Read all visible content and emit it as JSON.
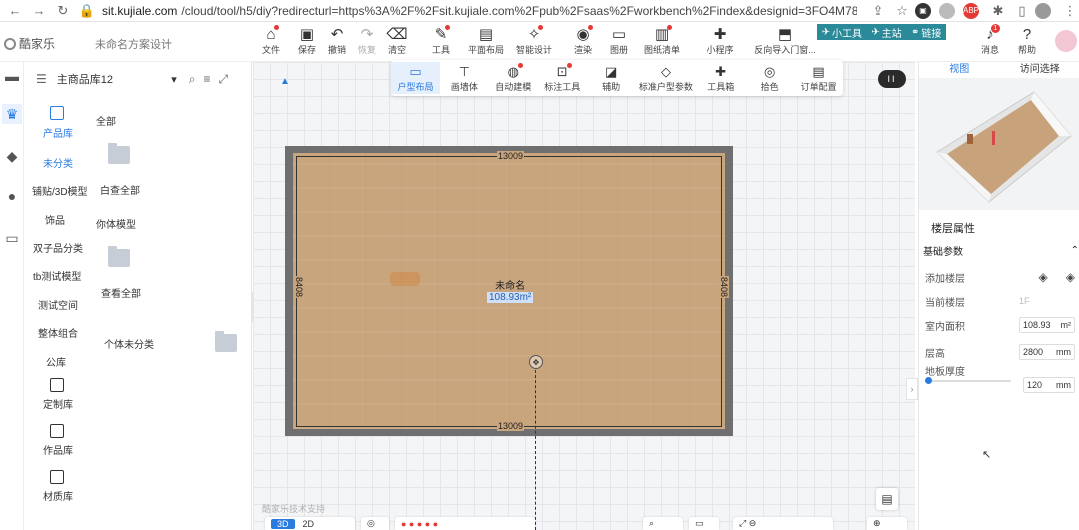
{
  "browser": {
    "url_host": "sit.kujiale.com",
    "url_path": "/cloud/tool/h5/diy?redirecturl=https%3A%2F%2Fsit.kujiale.com%2Fpub%2Fsaas%2Fworkbench%2Findex&designid=3FO4M78QXU7W&...",
    "ext_badge": "ABP"
  },
  "header": {
    "logo_text": "酷家乐",
    "project_name": "未命名方案设计",
    "toolbar": [
      {
        "label": "文件",
        "icon": "home-icon",
        "dot": true
      },
      {
        "label": "保存",
        "icon": "save-icon",
        "dot": false
      },
      {
        "label": "撤销",
        "icon": "undo-icon",
        "dot": false
      },
      {
        "label": "恢复",
        "icon": "redo-icon",
        "dot": false
      },
      {
        "label": "清空",
        "icon": "eraser-icon",
        "dot": false
      },
      {
        "label": "工具",
        "icon": "wrench-icon",
        "dot": true
      },
      {
        "label": "平面布局",
        "icon": "layout-icon",
        "dot": false
      },
      {
        "label": "智能设计",
        "icon": "magic-icon",
        "dot": true
      },
      {
        "label": "渲染",
        "icon": "camera-icon",
        "dot": true
      },
      {
        "label": "图册",
        "icon": "album-icon",
        "dot": false
      },
      {
        "label": "图纸清单",
        "icon": "list-icon",
        "dot": true
      },
      {
        "label": "小程序",
        "icon": "puzzle-icon",
        "dot": false
      },
      {
        "label": "反向导入门窗...",
        "icon": "import-icon",
        "dot": false
      }
    ],
    "teal_buttons": [
      "小工具",
      "主站",
      "链接"
    ],
    "right_buttons": [
      {
        "label": "消息",
        "icon": "bell-icon",
        "badge": "1"
      },
      {
        "label": "帮助",
        "icon": "help-icon",
        "badge": ""
      }
    ]
  },
  "left_panel": {
    "select_label": "主商品库12",
    "categories": [
      {
        "label": "产品库",
        "active": true
      },
      {
        "label": "未分类",
        "active": true
      },
      {
        "label": "铺贴/3D模型",
        "active": false
      },
      {
        "label": "饰品",
        "active": false
      },
      {
        "label": "双子品分类",
        "active": false
      },
      {
        "label": "tb测试模型",
        "active": false
      },
      {
        "label": "测试空间",
        "active": false
      },
      {
        "label": "整体组合",
        "active": false
      },
      {
        "label": "公库",
        "active": false
      },
      {
        "label": "定制库",
        "active": false
      },
      {
        "label": "作品库",
        "active": false
      },
      {
        "label": "材质库",
        "active": false
      }
    ],
    "subitems": [
      "全部",
      "白查全部",
      "你体模型",
      "查看全部",
      "个体未分类"
    ]
  },
  "floatbar": [
    {
      "label": "户型布局",
      "icon": "floorplan-icon",
      "active": true,
      "dot": false
    },
    {
      "label": "画墙体",
      "icon": "wall-icon",
      "active": false,
      "dot": false
    },
    {
      "label": "自动建模",
      "icon": "auto-icon",
      "active": false,
      "dot": true
    },
    {
      "label": "标注工具",
      "icon": "measure-icon",
      "active": false,
      "dot": true
    },
    {
      "label": "辅助",
      "icon": "ruler-icon",
      "active": false,
      "dot": false
    },
    {
      "label": "标准户型参数",
      "icon": "param-icon",
      "active": false,
      "dot": false
    },
    {
      "label": "工具箱",
      "icon": "toolbox-icon",
      "active": false,
      "dot": false
    },
    {
      "label": "拾色",
      "icon": "picker-icon",
      "active": false,
      "dot": false
    },
    {
      "label": "订单配置",
      "icon": "order-icon",
      "active": false,
      "dot": false
    }
  ],
  "room": {
    "name": "未命名",
    "area": "108.93m²",
    "dim_top": "13009",
    "dim_bottom": "13009",
    "dim_left": "8408",
    "dim_right": "8408"
  },
  "canvas": {
    "toggle_label": "II",
    "watermark": "酷家乐技术支持",
    "bottom": {
      "btn_3d": "3D",
      "btn_2d": "2D"
    }
  },
  "right_panel": {
    "tabs": [
      {
        "label": "视图",
        "active": true
      },
      {
        "label": "访问选择",
        "active": false
      }
    ],
    "section_title": "楼层属性",
    "group_title": "基础参数",
    "rows": [
      {
        "label": "添加楼层",
        "value": ""
      },
      {
        "label": "当前楼层",
        "value": "1F"
      },
      {
        "label": "室内面积",
        "value": "108.93",
        "unit": "m²"
      },
      {
        "label": "层高",
        "value": "2800",
        "unit": "mm"
      },
      {
        "label": "地板厚度",
        "value": "120",
        "unit": "mm"
      }
    ]
  }
}
